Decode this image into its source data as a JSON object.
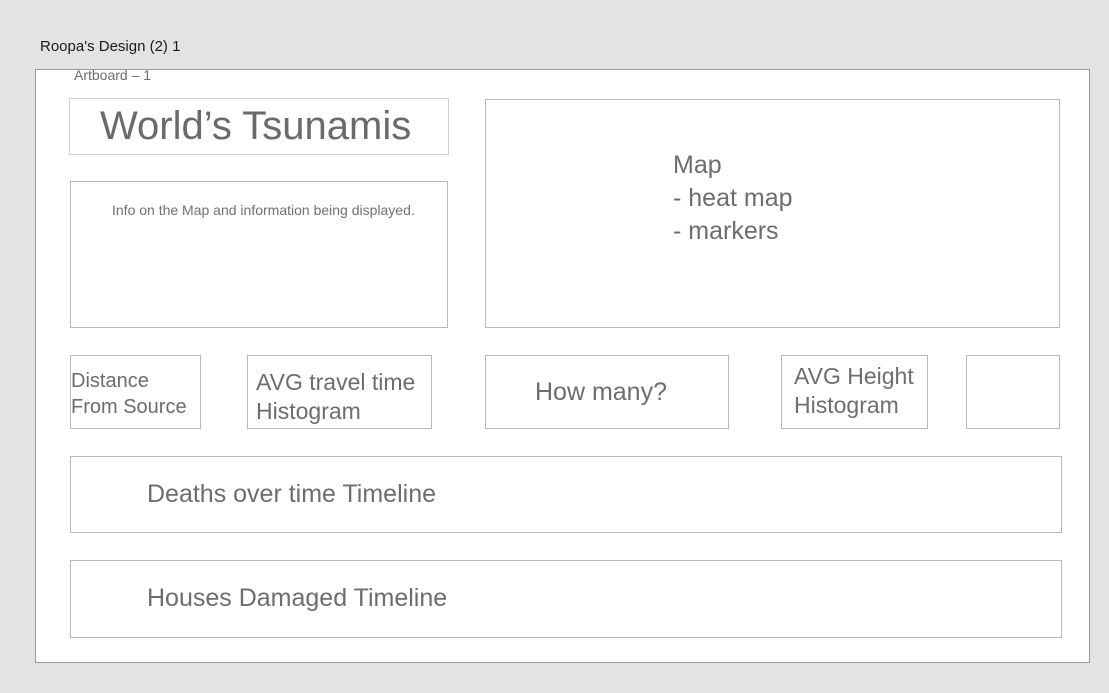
{
  "file": {
    "title": "Roopa's Design (2) 1"
  },
  "artboard": {
    "label": "Artboard – 1"
  },
  "header": {
    "title": "World’s Tsunamis"
  },
  "info": {
    "text": "Info on the Map and information being displayed."
  },
  "map": {
    "lines": [
      "Map",
      "- heat map",
      "- markers"
    ]
  },
  "widgets": {
    "distance": {
      "lines": [
        "Distance",
        "From Source"
      ]
    },
    "travel_time": {
      "lines": [
        "AVG travel time",
        "Histogram"
      ]
    },
    "how_many": {
      "label": "How many?"
    },
    "avg_height": {
      "lines": [
        "AVG Height",
        "Histogram"
      ]
    }
  },
  "timelines": {
    "deaths": {
      "label": "Deaths over time Timeline"
    },
    "houses": {
      "label": "Houses Damaged Timeline"
    }
  },
  "colors": {
    "canvas": "#e3e3e3",
    "artboard": "#ffffff",
    "box_border": "#b8b8b8",
    "text": "#6d6d6d"
  }
}
